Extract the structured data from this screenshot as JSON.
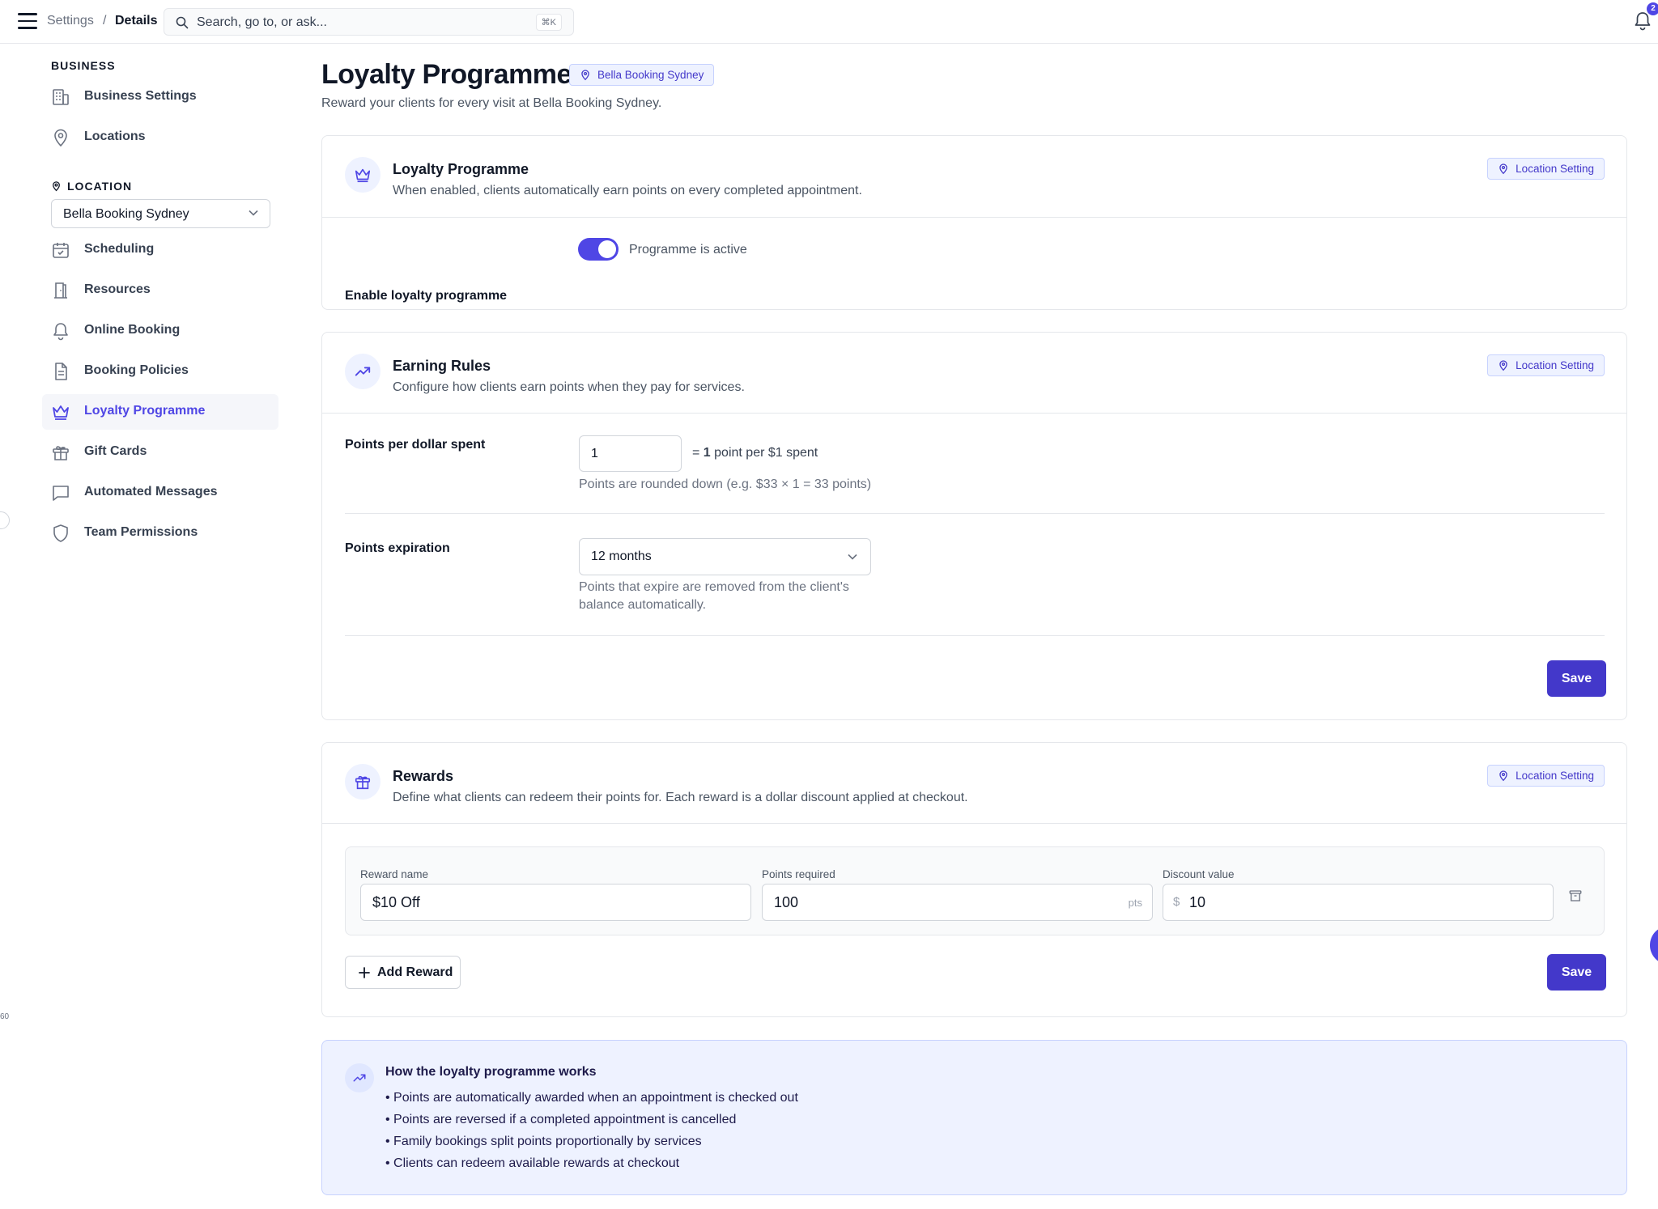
{
  "topbar": {
    "breadcrumb_root": "Settings",
    "breadcrumb_sep": "/",
    "breadcrumb_current": "Details",
    "search_placeholder": "Search, go to, or ask...",
    "search_shortcut": "⌘K",
    "notification_count": "2"
  },
  "sidebar": {
    "business_heading": "BUSINESS",
    "business_items": [
      {
        "label": "Business Settings",
        "icon": "building-icon"
      },
      {
        "label": "Locations",
        "icon": "map-pin-icon"
      }
    ],
    "location_heading": "LOCATION",
    "location_selected": "Bella Booking Sydney",
    "location_items": [
      {
        "label": "Scheduling",
        "icon": "calendar-check-icon"
      },
      {
        "label": "Resources",
        "icon": "door-icon"
      },
      {
        "label": "Online Booking",
        "icon": "bell-icon"
      },
      {
        "label": "Booking Policies",
        "icon": "document-icon"
      },
      {
        "label": "Loyalty Programme",
        "icon": "crown-icon",
        "active": true
      },
      {
        "label": "Gift Cards",
        "icon": "gift-icon"
      },
      {
        "label": "Automated Messages",
        "icon": "message-icon"
      },
      {
        "label": "Team Permissions",
        "icon": "shield-icon"
      }
    ],
    "footer_fragment": "60"
  },
  "page": {
    "title": "Loyalty Programme",
    "location_badge": "Bella Booking Sydney",
    "subtitle": "Reward your clients for every visit at Bella Booking Sydney."
  },
  "loyalty_card": {
    "title": "Loyalty Programme",
    "description": "When enabled, clients automatically earn points on every completed appointment.",
    "badge": "Location Setting",
    "enable_label": "Enable loyalty programme",
    "toggle_on": true,
    "toggle_status": "Programme is active"
  },
  "earning_card": {
    "title": "Earning Rules",
    "description": "Configure how clients earn points when they pay for services.",
    "badge": "Location Setting",
    "points_label": "Points per dollar spent",
    "points_value": "1",
    "points_eq_prefix": "= ",
    "points_eq_bold": "1",
    "points_eq_suffix": " point per $1 spent",
    "points_hint": "Points are rounded down (e.g. $33 × 1 = 33 points)",
    "expiration_label": "Points expiration",
    "expiration_value": "12 months",
    "expiration_hint_line1": "Points that expire are removed from the client's",
    "expiration_hint_line2": "balance automatically.",
    "save_label": "Save"
  },
  "rewards_card": {
    "title": "Rewards",
    "description": "Define what clients can redeem their points for. Each reward is a dollar discount applied at checkout.",
    "badge": "Location Setting",
    "reward_name_label": "Reward name",
    "reward_name_value": "$10 Off",
    "points_required_label": "Points required",
    "points_required_value": "100",
    "points_suffix": "pts",
    "discount_label": "Discount value",
    "discount_prefix": "$",
    "discount_value": "10",
    "add_reward_label": "Add Reward",
    "save_label": "Save"
  },
  "info_card": {
    "title": "How the loyalty programme works",
    "items": [
      "• Points are automatically awarded when an appointment is checked out",
      "• Points are reversed if a completed appointment is cancelled",
      "• Family bookings split points proportionally by services",
      "• Clients can redeem available rewards at checkout"
    ]
  },
  "colors": {
    "accent": "#4f46e5",
    "accent_dark": "#4338ca",
    "badge_bg": "#eef2ff",
    "border": "#e5e7eb"
  }
}
